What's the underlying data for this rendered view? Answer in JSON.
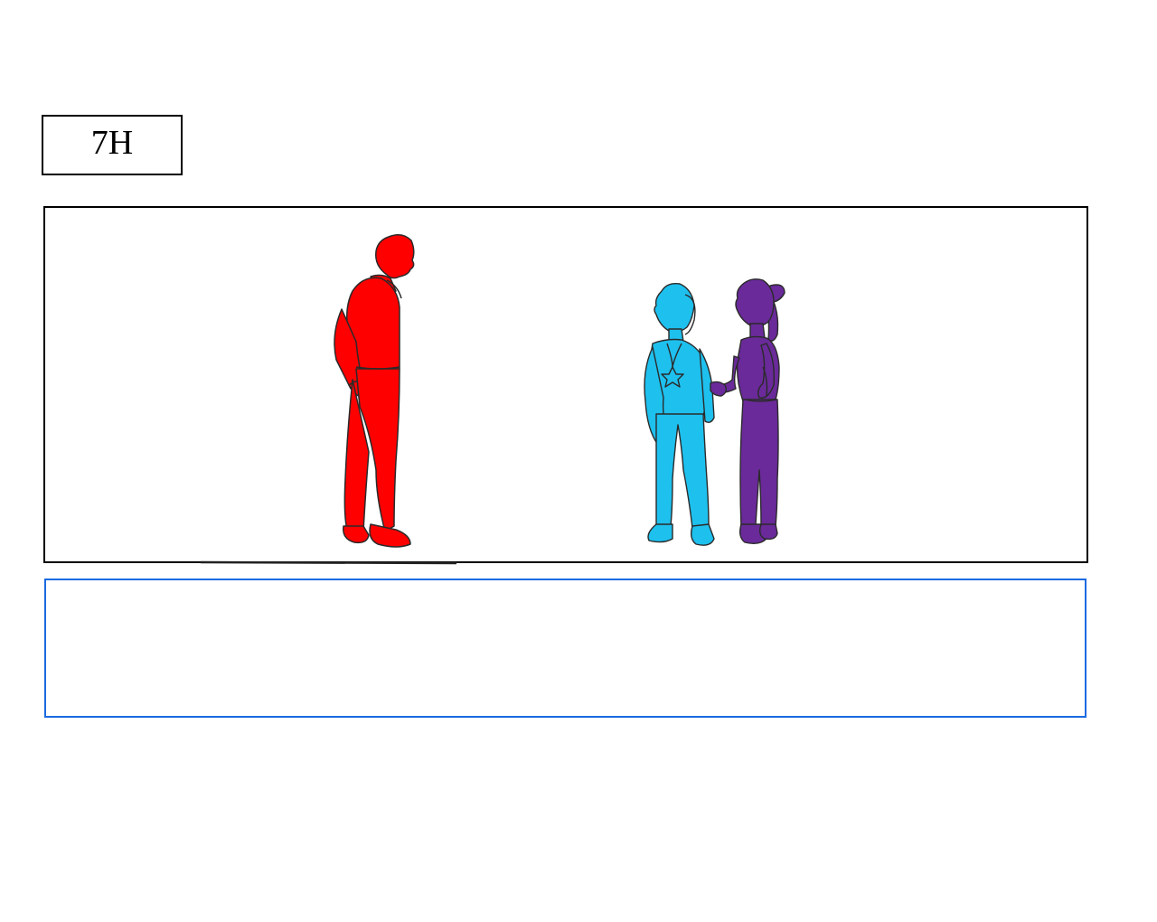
{
  "panel_label": "7H",
  "caption": "",
  "figures": [
    {
      "name": "red-figure",
      "color": "#ff0000"
    },
    {
      "name": "cyan-figure",
      "color": "#1ec0ee"
    },
    {
      "name": "purple-figure",
      "color": "#6a2a9a"
    }
  ],
  "colors": {
    "panel_border": "#000000",
    "caption_border": "#1a6ae0",
    "sketch_line": "#2a2a2a"
  }
}
